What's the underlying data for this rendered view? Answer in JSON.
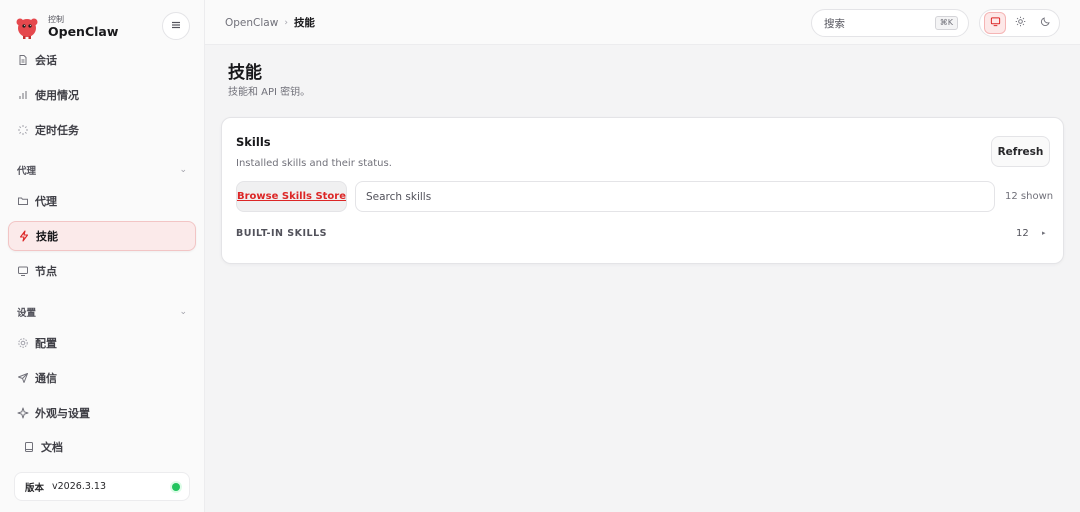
{
  "brand": {
    "sub": "控制",
    "name": "OpenClaw"
  },
  "nav": {
    "top_items": [
      {
        "label": "会话",
        "icon": "file-text-icon"
      },
      {
        "label": "使用情况",
        "icon": "bar-chart-icon"
      },
      {
        "label": "定时任务",
        "icon": "loader-icon"
      }
    ],
    "agent_section": "代理",
    "agent_items": [
      {
        "label": "代理",
        "icon": "folder-icon"
      },
      {
        "label": "技能",
        "icon": "zap-icon",
        "active": true
      },
      {
        "label": "节点",
        "icon": "monitor-icon"
      }
    ],
    "settings_section": "设置",
    "settings_items": [
      {
        "label": "配置",
        "icon": "gear-icon"
      },
      {
        "label": "通信",
        "icon": "send-icon"
      },
      {
        "label": "外观与设置",
        "icon": "sparkle-icon"
      }
    ],
    "docs": {
      "label": "文档",
      "icon": "book-icon"
    },
    "version": {
      "label": "版本",
      "value": "v2026.3.13",
      "status_color": "#22c55e"
    }
  },
  "topbar": {
    "breadcrumb_root": "OpenClaw",
    "breadcrumb_sep": "›",
    "breadcrumb_current": "技能",
    "search_placeholder": "搜索",
    "search_shortcut": "⌘K"
  },
  "page": {
    "title": "技能",
    "subtitle": "技能和 API 密钥。"
  },
  "skills_card": {
    "title": "Skills",
    "description": "Installed skills and their status.",
    "refresh_label": "Refresh",
    "store_label": "Browse Skills Store",
    "search_placeholder": "Search skills",
    "shown_count": "12 shown",
    "group_label": "BUILT-IN SKILLS",
    "group_count": "12",
    "group_caret": "▸"
  },
  "colors": {
    "accent": "#dc2626",
    "active_bg": "#fbeaea",
    "status_ok": "#22c55e"
  }
}
